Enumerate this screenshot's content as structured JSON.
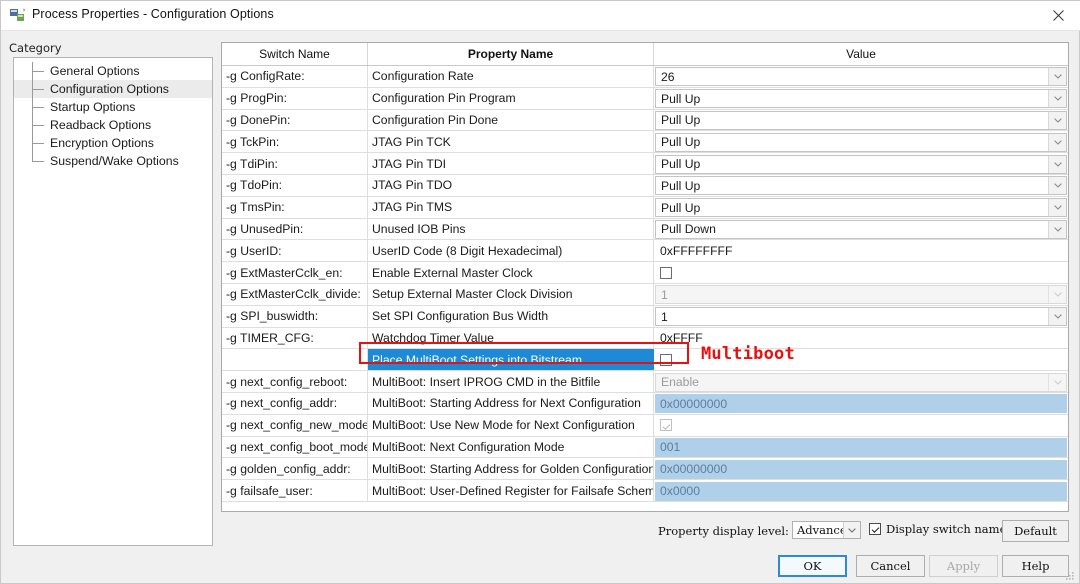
{
  "window": {
    "title": "Process Properties - Configuration Options",
    "icon": "process-properties-icon",
    "close_icon": "close-icon"
  },
  "sidebar": {
    "label": "Category",
    "items": [
      {
        "label": "General Options",
        "selected": false
      },
      {
        "label": "Configuration Options",
        "selected": true
      },
      {
        "label": "Startup Options",
        "selected": false
      },
      {
        "label": "Readback Options",
        "selected": false
      },
      {
        "label": "Encryption Options",
        "selected": false
      },
      {
        "label": "Suspend/Wake Options",
        "selected": false
      }
    ]
  },
  "grid": {
    "headers": {
      "switch": "Switch Name",
      "property": "Property Name",
      "value": "Value"
    },
    "rows": [
      {
        "switch": "-g ConfigRate:",
        "property": "Configuration Rate",
        "value": "26",
        "kind": "combo"
      },
      {
        "switch": "-g ProgPin:",
        "property": "Configuration Pin Program",
        "value": "Pull Up",
        "kind": "combo"
      },
      {
        "switch": "-g DonePin:",
        "property": "Configuration Pin Done",
        "value": "Pull Up",
        "kind": "combo"
      },
      {
        "switch": "-g TckPin:",
        "property": "JTAG Pin TCK",
        "value": "Pull Up",
        "kind": "combo"
      },
      {
        "switch": "-g TdiPin:",
        "property": "JTAG Pin TDI",
        "value": "Pull Up",
        "kind": "combo"
      },
      {
        "switch": "-g TdoPin:",
        "property": "JTAG Pin TDO",
        "value": "Pull Up",
        "kind": "combo"
      },
      {
        "switch": "-g TmsPin:",
        "property": "JTAG Pin TMS",
        "value": "Pull Up",
        "kind": "combo"
      },
      {
        "switch": "-g UnusedPin:",
        "property": "Unused IOB Pins",
        "value": "Pull Down",
        "kind": "combo"
      },
      {
        "switch": "-g UserID:",
        "property": "UserID Code (8 Digit Hexadecimal)",
        "value": "0xFFFFFFFF",
        "kind": "text"
      },
      {
        "switch": "-g ExtMasterCclk_en:",
        "property": "Enable External Master Clock",
        "value": "",
        "kind": "checkbox",
        "checked": false
      },
      {
        "switch": "-g ExtMasterCclk_divide:",
        "property": "Setup External Master Clock Division",
        "value": "1",
        "kind": "combo-disabled"
      },
      {
        "switch": "-g SPI_buswidth:",
        "property": "Set SPI Configuration Bus Width",
        "value": "1",
        "kind": "combo"
      },
      {
        "switch": "-g TIMER_CFG:",
        "property": "Watchdog Timer Value",
        "value": "0xFFFF",
        "kind": "text"
      },
      {
        "switch": "",
        "property": "Place MultiBoot Settings into Bitstream",
        "value": "",
        "kind": "checkbox",
        "checked": false,
        "selected": true
      },
      {
        "switch": "-g next_config_reboot:",
        "property": "MultiBoot: Insert IPROG CMD in the Bitfile",
        "value": "Enable",
        "kind": "combo-disabled"
      },
      {
        "switch": "-g next_config_addr:",
        "property": "MultiBoot: Starting Address for Next Configuration",
        "value": "0x00000000",
        "kind": "text-disabled"
      },
      {
        "switch": "-g next_config_new_mode:",
        "property": "MultiBoot: Use New Mode for Next Configuration",
        "value": "",
        "kind": "checkbox-disabled",
        "checked": true
      },
      {
        "switch": "-g next_config_boot_mode:",
        "property": "MultiBoot: Next Configuration Mode",
        "value": "001",
        "kind": "text-disabled"
      },
      {
        "switch": "-g golden_config_addr:",
        "property": "MultiBoot: Starting Address for Golden Configuration",
        "value": "0x00000000",
        "kind": "text-disabled"
      },
      {
        "switch": "-g failsafe_user:",
        "property": "MultiBoot: User-Defined Register for Failsafe Scheme",
        "value": "0x0000",
        "kind": "text-disabled"
      }
    ]
  },
  "annotation": {
    "multiboot_label": "Multiboot",
    "highlight_color": "#e8110f"
  },
  "footer": {
    "display_level_label": "Property display level:",
    "display_level_value": "Advanced",
    "display_switch_names_label": "Display switch names",
    "display_switch_names_checked": true,
    "default_button": "Default",
    "ok_button": "OK",
    "cancel_button": "Cancel",
    "apply_button": "Apply",
    "help_button": "Help"
  },
  "colors": {
    "selection_blue": "#1e8ad6",
    "disabled_value_blue": "#b0cfe8",
    "accent_red": "#e8110f"
  }
}
